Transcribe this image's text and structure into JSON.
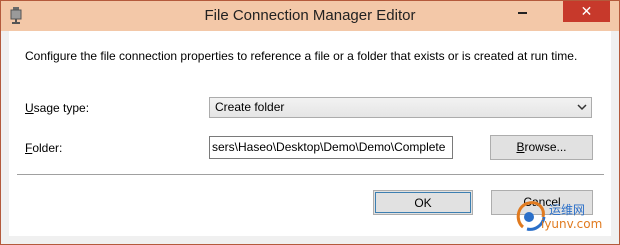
{
  "window": {
    "title": "File Connection Manager Editor",
    "close_glyph": "✕"
  },
  "dialog": {
    "description": "Configure the file connection properties to reference a file or a folder that exists or is created at run time.",
    "usage_type": {
      "label_accel": "U",
      "label_rest": "sage type:",
      "value": "Create folder"
    },
    "folder": {
      "label_accel": "F",
      "label_rest": "older:",
      "value": "sers\\Haseo\\Desktop\\Demo\\Demo\\Complete"
    },
    "browse": {
      "label_accel": "B",
      "label_rest": "rowse..."
    },
    "ok_label": "OK",
    "cancel_label": "Cancel"
  },
  "watermark": {
    "text": "运维网",
    "domain": "iyunv.com"
  }
}
